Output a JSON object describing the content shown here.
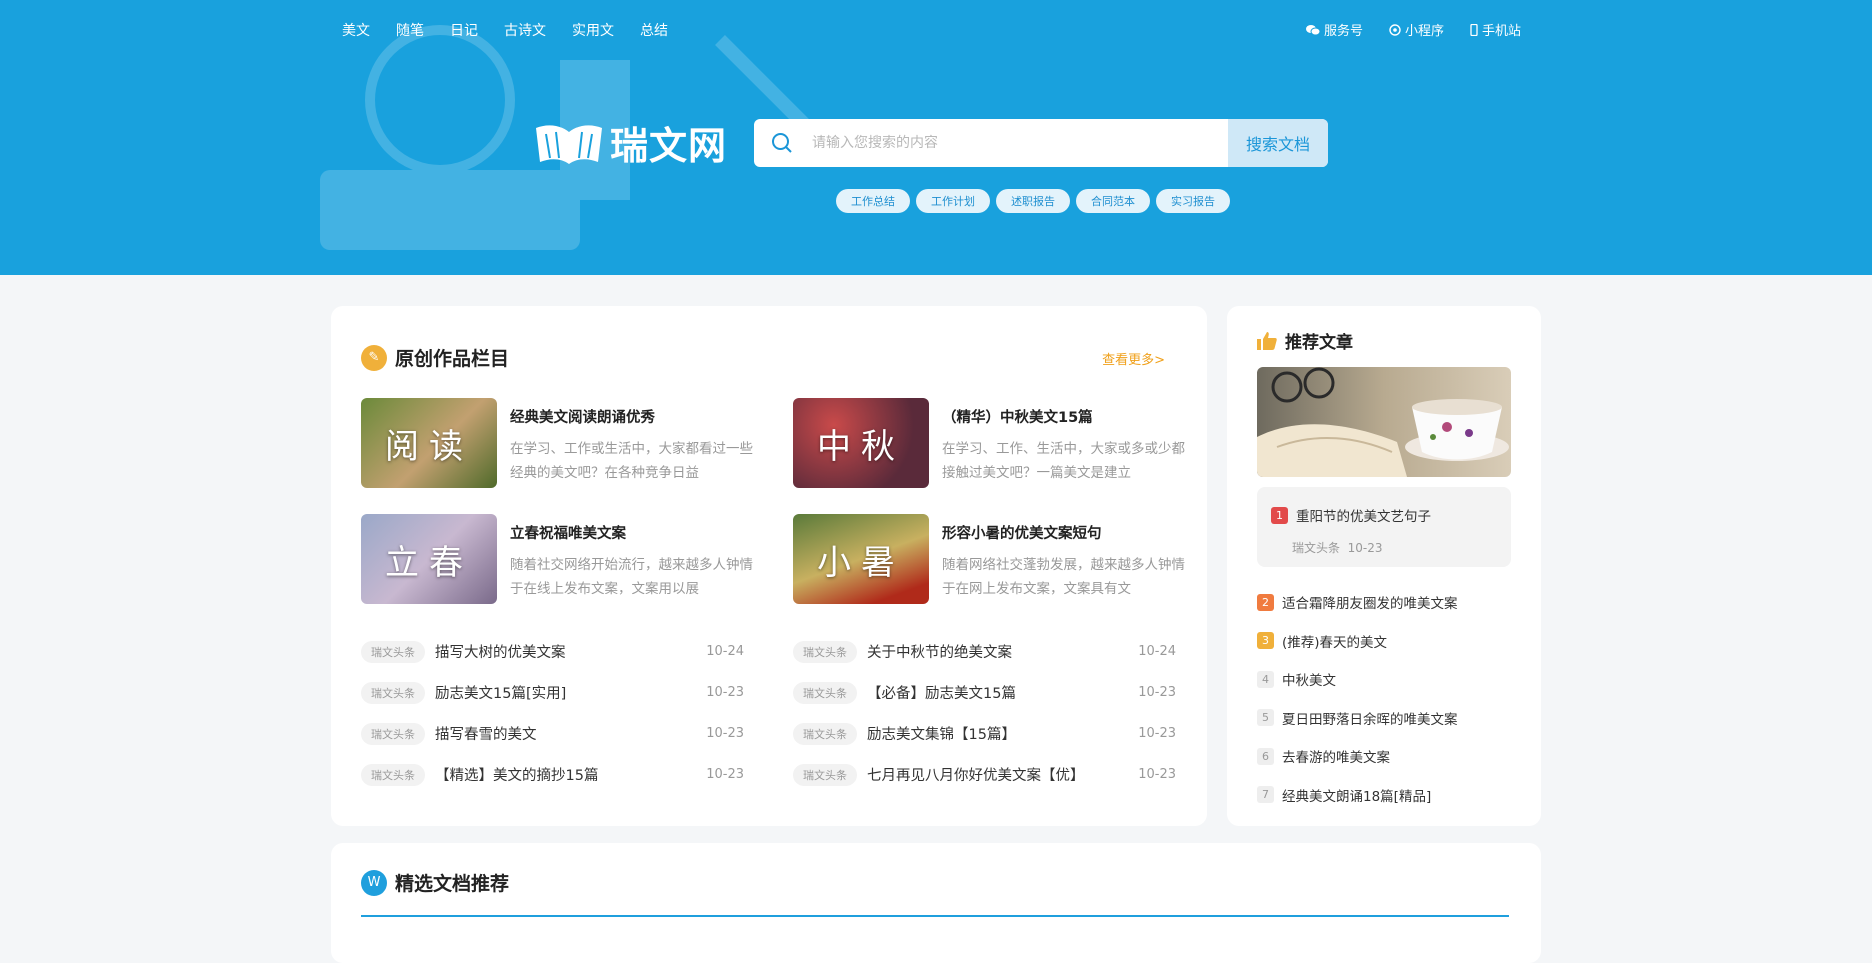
{
  "nav": {
    "items": [
      "美文",
      "随笔",
      "日记",
      "古诗文",
      "实用文",
      "总结"
    ],
    "links": [
      "服务号",
      "小程序",
      "手机站"
    ]
  },
  "brand": {
    "name": "瑞文网"
  },
  "search": {
    "placeholder": "请输入您搜索的内容",
    "button": "搜索文档"
  },
  "tags": [
    "工作总结",
    "工作计划",
    "述职报告",
    "合同范本",
    "实习报告"
  ],
  "original": {
    "title": "原创作品栏目",
    "more": "查看更多>",
    "featured": [
      {
        "thumb": "阅读",
        "title": "经典美文阅读朗诵优秀",
        "desc": "在学习、工作或生活中，大家都看过一些经典的美文吧？在各种竞争日益"
      },
      {
        "thumb": "中秋",
        "title": "（精华）中秋美文15篇",
        "desc": "在学习、工作、生活中，大家或多或少都接触过美文吧？一篇美文是建立"
      },
      {
        "thumb": "立春",
        "title": "立春祝福唯美文案",
        "desc": "随着社交网络开始流行，越来越多人钟情于在线上发布文案，文案用以展"
      },
      {
        "thumb": "小暑",
        "title": "形容小暑的优美文案短句",
        "desc": "随着网络社交蓬勃发展，越来越多人钟情于在网上发布文案，文案具有文"
      }
    ],
    "list_left": [
      {
        "src": "瑞文头条",
        "title": "描写大树的优美文案",
        "date": "10-24"
      },
      {
        "src": "瑞文头条",
        "title": "励志美文15篇[实用]",
        "date": "10-23"
      },
      {
        "src": "瑞文头条",
        "title": "描写春雪的美文",
        "date": "10-23"
      },
      {
        "src": "瑞文头条",
        "title": "【精选】美文的摘抄15篇",
        "date": "10-23"
      }
    ],
    "list_right": [
      {
        "src": "瑞文头条",
        "title": "关于中秋节的绝美文案",
        "date": "10-24"
      },
      {
        "src": "瑞文头条",
        "title": "【必备】励志美文15篇",
        "date": "10-23"
      },
      {
        "src": "瑞文头条",
        "title": "励志美文集锦【15篇】",
        "date": "10-23"
      },
      {
        "src": "瑞文头条",
        "title": "七月再见八月你好优美文案【优】",
        "date": "10-23"
      }
    ]
  },
  "recommend": {
    "title": "推荐文章",
    "top": {
      "rank": "1",
      "title": "重阳节的优美文艺句子",
      "source": "瑞文头条",
      "date": "10-23"
    },
    "items": [
      {
        "rank": "2",
        "title": "适合霜降朋友圈发的唯美文案"
      },
      {
        "rank": "3",
        "title": "(推荐)春天的美文"
      },
      {
        "rank": "4",
        "title": "中秋美文"
      },
      {
        "rank": "5",
        "title": "夏日田野落日余晖的唯美文案"
      },
      {
        "rank": "6",
        "title": "去春游的唯美文案"
      },
      {
        "rank": "7",
        "title": "经典美文朗诵18篇[精品]"
      }
    ]
  },
  "docs": {
    "title": "精选文档推荐"
  },
  "colors": {
    "brand": "#19a1dd",
    "orange": "#f0a01a",
    "rank1": "#e24a4a",
    "rank2": "#f07b3f",
    "rank3": "#f0b03a"
  }
}
